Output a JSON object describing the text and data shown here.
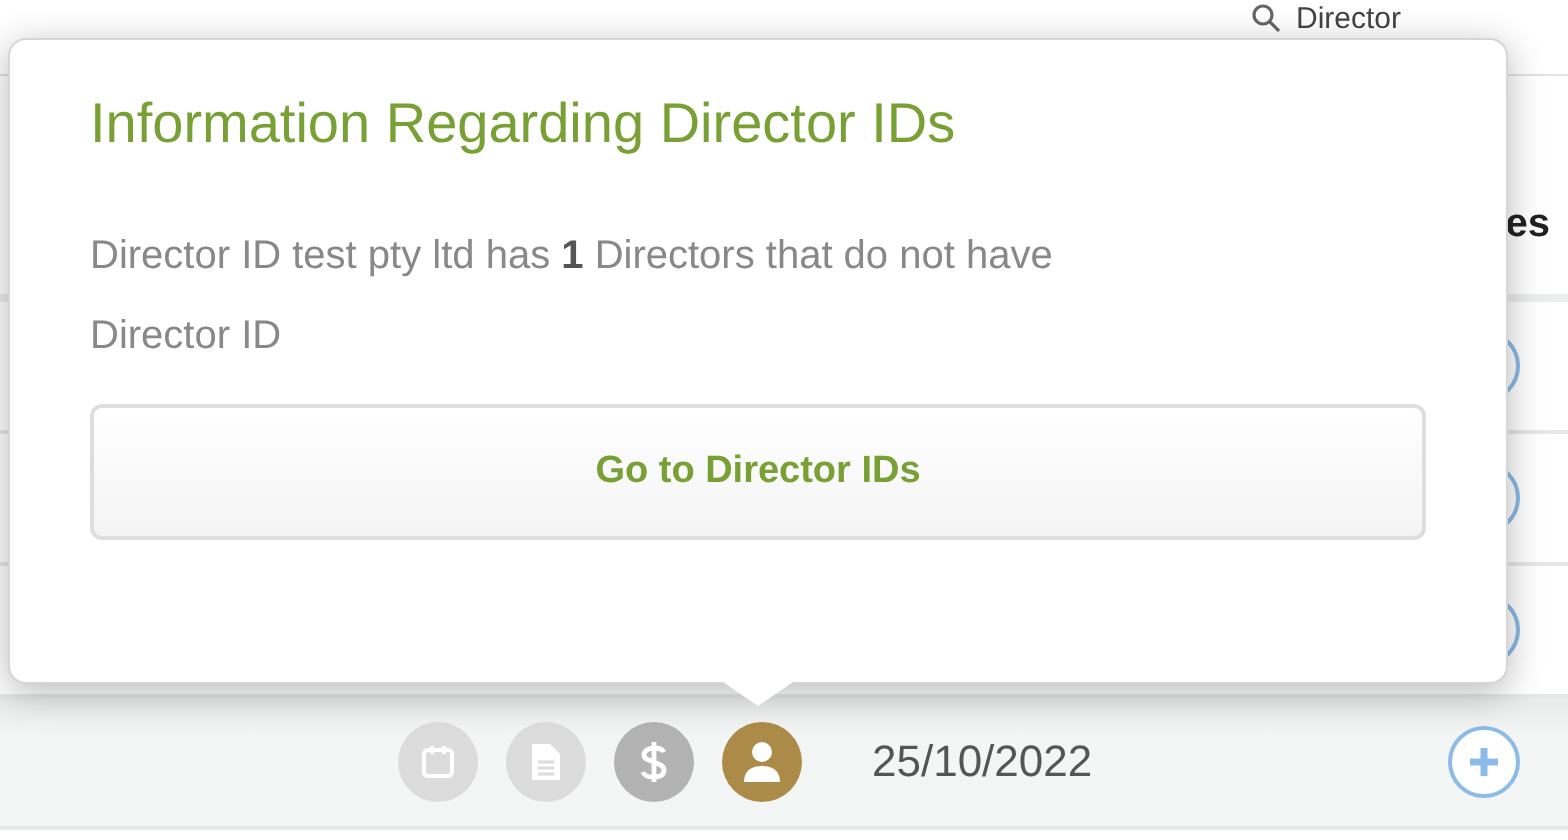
{
  "search": {
    "value": "Director"
  },
  "table": {
    "columns": [
      {
        "label": "es"
      }
    ],
    "rows": [
      {
        "kind": "covered"
      },
      {
        "kind": "covered"
      },
      {
        "kind": "covered"
      },
      {
        "kind": "full",
        "date": "25/10/2022",
        "status_icons": [
          {
            "kind": "calendar",
            "color": "#dcdcdc"
          },
          {
            "kind": "document",
            "color": "#dcdcdc"
          },
          {
            "kind": "dollar",
            "color": "#b3b3b3"
          },
          {
            "kind": "person",
            "color": "#ac8a47"
          }
        ]
      }
    ]
  },
  "popover": {
    "title": "Information Regarding Director IDs",
    "message": "Director ID test pty ltd has **1** Directors that do not have Director ID",
    "button": "Go to Director IDs"
  }
}
